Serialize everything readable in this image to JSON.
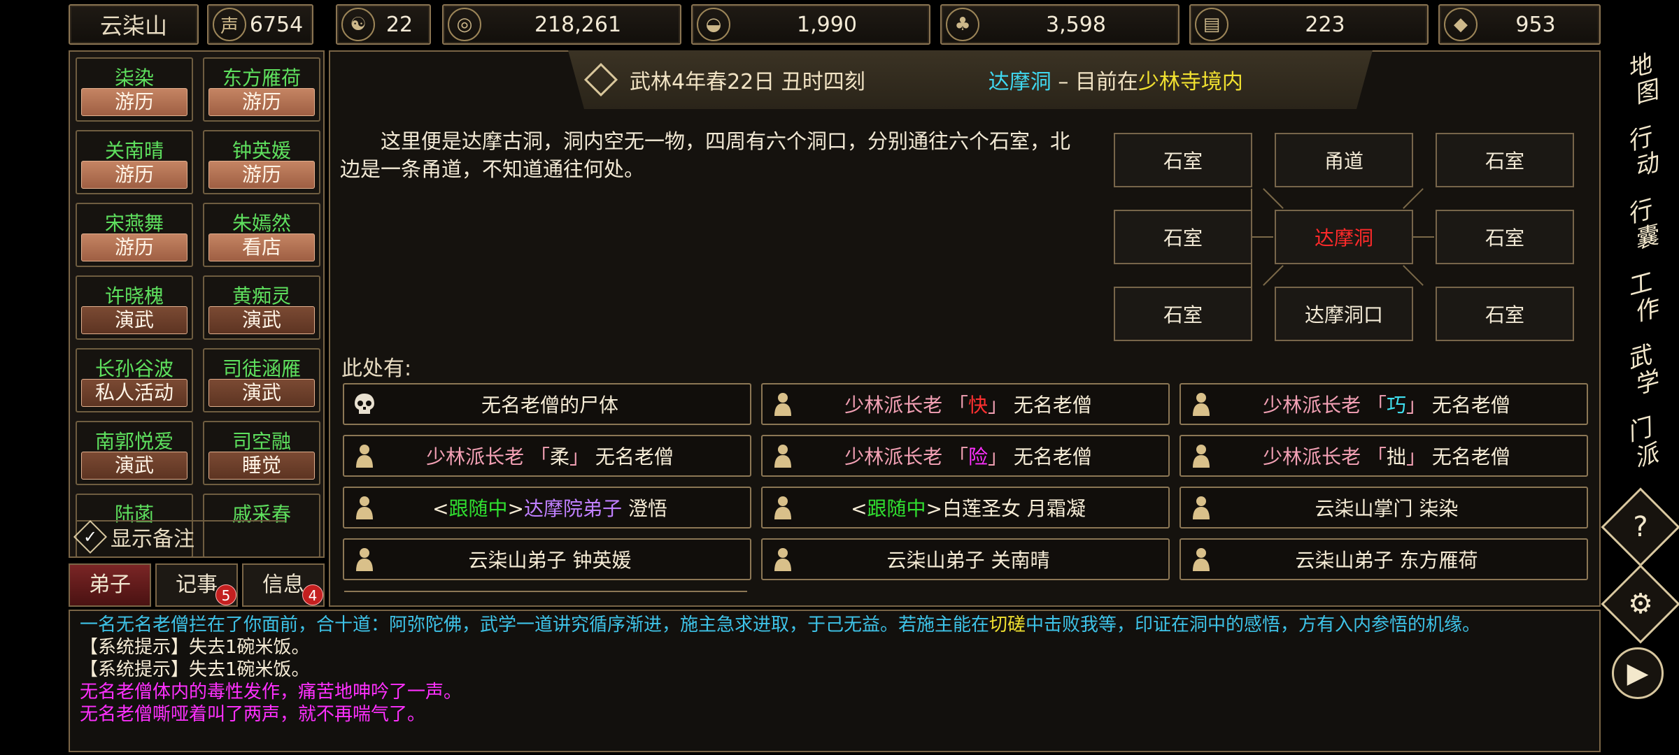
{
  "top_bar": {
    "sect_name": "云柒山",
    "resources": [
      {
        "icon": "reputation-icon",
        "value": "6754"
      },
      {
        "icon": "yin-yang-icon",
        "value": "22"
      },
      {
        "icon": "coin-icon",
        "value": "218,261"
      },
      {
        "icon": "rice-bowl-icon",
        "value": "1,990"
      },
      {
        "icon": "herb-icon",
        "value": "3,598"
      },
      {
        "icon": "wood-icon",
        "value": "223"
      },
      {
        "icon": "ore-icon",
        "value": "953"
      }
    ]
  },
  "disciples": [
    {
      "name": "柒染",
      "status": "游历"
    },
    {
      "name": "东方雁荷",
      "status": "游历"
    },
    {
      "name": "关南晴",
      "status": "游历"
    },
    {
      "name": "钟英媛",
      "status": "游历"
    },
    {
      "name": "宋燕舞",
      "status": "游历"
    },
    {
      "name": "朱嫣然",
      "status": "看店"
    },
    {
      "name": "许晓槐",
      "status": "演武"
    },
    {
      "name": "黄痴灵",
      "status": "演武"
    },
    {
      "name": "长孙谷波",
      "status": "私人活动"
    },
    {
      "name": "司徒涵雁",
      "status": "演武"
    },
    {
      "name": "南郭悦爱",
      "status": "演武"
    },
    {
      "name": "司空融",
      "status": "睡觉"
    },
    {
      "name": "陆菡",
      "status": ""
    },
    {
      "name": "戚采春",
      "status": ""
    }
  ],
  "show_notes_label": "显示备注",
  "tabs": [
    {
      "label": "弟子",
      "badge": ""
    },
    {
      "label": "记事",
      "badge": "5"
    },
    {
      "label": "信息",
      "badge": "4"
    }
  ],
  "header": {
    "date": "武林4年春22日 丑时四刻",
    "location_name": "达摩洞",
    "separator": " – 目前在",
    "region": "少林寺境内"
  },
  "description": "　　这里便是达摩古洞，洞内空无一物，四周有六个洞口，分别通往六个石室，北边是一条甬道，不知道通往何处。",
  "map": {
    "rooms": [
      "石室",
      "甬道",
      "石室",
      "石室",
      "达摩洞",
      "石室",
      "石室",
      "达摩洞口",
      "石室"
    ]
  },
  "here_label": "此处有:",
  "entities": [
    {
      "icon": "skull-icon",
      "parts": [
        {
          "t": "无名老僧的尸体",
          "c": "#f6ecd6"
        }
      ]
    },
    {
      "icon": "person-icon",
      "parts": [
        {
          "t": "少林派长老 「",
          "c": "#f2a0b4"
        },
        {
          "t": "快",
          "c": "#ff3030"
        },
        {
          "t": "」 ",
          "c": "#f2a0b4"
        },
        {
          "t": "无名老僧",
          "c": "#f6ecd6"
        }
      ]
    },
    {
      "icon": "person-icon",
      "parts": [
        {
          "t": "少林派长老 「",
          "c": "#f2a0b4"
        },
        {
          "t": "巧",
          "c": "#40e0f0"
        },
        {
          "t": "」 ",
          "c": "#f2a0b4"
        },
        {
          "t": "无名老僧",
          "c": "#f6ecd6"
        }
      ]
    },
    {
      "icon": "person-icon",
      "parts": [
        {
          "t": "少林派长老 「",
          "c": "#f2a0b4"
        },
        {
          "t": "柔",
          "c": "#f6ecd6"
        },
        {
          "t": "」 ",
          "c": "#f2a0b4"
        },
        {
          "t": "无名老僧",
          "c": "#f6ecd6"
        }
      ]
    },
    {
      "icon": "person-icon",
      "parts": [
        {
          "t": "少林派长老 「",
          "c": "#f2a0b4"
        },
        {
          "t": "险",
          "c": "#ff30ff"
        },
        {
          "t": "」 ",
          "c": "#f2a0b4"
        },
        {
          "t": "无名老僧",
          "c": "#f6ecd6"
        }
      ]
    },
    {
      "icon": "person-icon",
      "parts": [
        {
          "t": "少林派长老 「",
          "c": "#f2a0b4"
        },
        {
          "t": "拙",
          "c": "#f6ecd6"
        },
        {
          "t": "」 ",
          "c": "#f2a0b4"
        },
        {
          "t": "无名老僧",
          "c": "#f6ecd6"
        }
      ]
    },
    {
      "icon": "person-icon",
      "parts": [
        {
          "t": "<",
          "c": "#f6ecd6"
        },
        {
          "t": "跟随中",
          "c": "#30e030"
        },
        {
          "t": ">",
          "c": "#f6ecd6"
        },
        {
          "t": "达摩院弟子",
          "c": "#c080ff"
        },
        {
          "t": " 澄悟",
          "c": "#f6ecd6"
        }
      ]
    },
    {
      "icon": "person-icon",
      "parts": [
        {
          "t": "<",
          "c": "#f6ecd6"
        },
        {
          "t": "跟随中",
          "c": "#30e030"
        },
        {
          "t": ">",
          "c": "#f6ecd6"
        },
        {
          "t": "白莲圣女 月霜凝",
          "c": "#f6ecd6"
        }
      ]
    },
    {
      "icon": "person-icon",
      "parts": [
        {
          "t": "云柒山掌门 柒染",
          "c": "#f6ecd6"
        }
      ]
    },
    {
      "icon": "person-icon",
      "parts": [
        {
          "t": "云柒山弟子 钟英媛",
          "c": "#f6ecd6"
        }
      ]
    },
    {
      "icon": "person-icon",
      "parts": [
        {
          "t": "云柒山弟子 关南晴",
          "c": "#f6ecd6"
        }
      ]
    },
    {
      "icon": "person-icon",
      "parts": [
        {
          "t": "云柒山弟子 东方雁荷",
          "c": "#f6ecd6"
        }
      ]
    }
  ],
  "nav": [
    {
      "label": "地图",
      "icon": ""
    },
    {
      "label": "行动",
      "icon": ""
    },
    {
      "label": "行囊",
      "icon": ""
    },
    {
      "label": "工作",
      "icon": ""
    },
    {
      "label": "武学",
      "icon": ""
    },
    {
      "label": "门派",
      "icon": ""
    },
    {
      "label": "",
      "icon": "help-icon"
    },
    {
      "label": "",
      "icon": "settings-icon"
    },
    {
      "label": "",
      "icon": "play-icon"
    }
  ],
  "log": [
    {
      "parts": [
        {
          "t": "一名无名老僧拦在了你面前，合十道：阿弥陀佛，武学一道讲究循序渐进，施主急求进取，于己无益。若施主能在",
          "c": "#3ec3e8"
        },
        {
          "t": "切磋",
          "c": "#f0e030"
        },
        {
          "t": "中击败我等，印证在洞中的感悟，方有入内参悟的机缘。",
          "c": "#3ec3e8"
        }
      ]
    },
    {
      "parts": [
        {
          "t": "【系统提示】失去1碗米饭。",
          "c": "#f6ecd6"
        }
      ]
    },
    {
      "parts": [
        {
          "t": "【系统提示】失去1碗米饭。",
          "c": "#f6ecd6"
        }
      ]
    },
    {
      "parts": [
        {
          "t": "无名老僧体内的毒性发作，痛苦地呻吟了一声。",
          "c": "#ff30ff"
        }
      ]
    },
    {
      "parts": [
        {
          "t": "无名老僧嘶哑着叫了两声，就不再喘气了。",
          "c": "#ff30ff"
        }
      ]
    }
  ],
  "colors": {
    "location_name": "#40d8f0",
    "region": "#f0e030",
    "center_room": "#ff2a2a",
    "disciple_name": "#5ee05e"
  }
}
